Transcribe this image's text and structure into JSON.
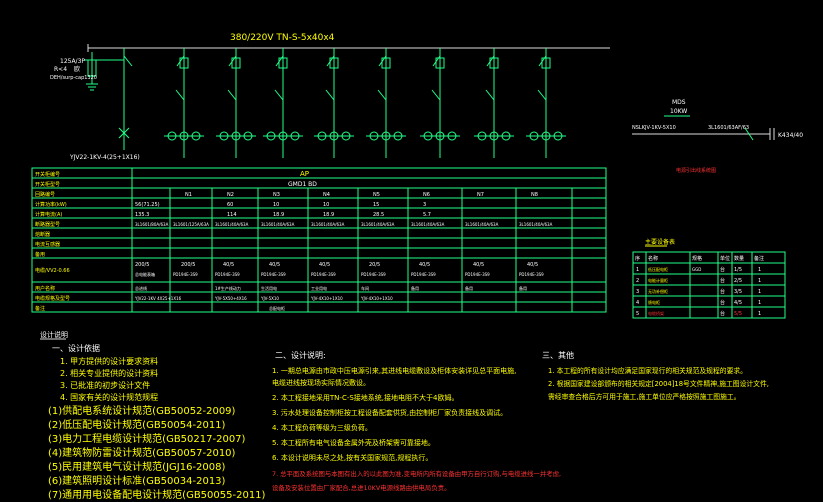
{
  "bus_label": "380/220V TN-S-5x40x4",
  "incoming": {
    "cb": "125A/3P",
    "r_label": "R<4",
    "r_unit": "欧",
    "spd": "DEH/surp-cap1320",
    "cable": "YJV22-1KV-4(25+1X16)"
  },
  "right_block": {
    "top1": "MDS",
    "top2": "10KW",
    "cable": "NSLKJV-1KV-5X10",
    "breaker": "3L1601/63AF/63",
    "code": "K434/40",
    "title": "电源引出线系统图"
  },
  "main_table": {
    "header_left": "开关柜编号",
    "panel_name": "AP",
    "panel_type": "GMD1 BD",
    "row_labels": [
      "开关柜编号",
      "开关柜型号",
      "回路编号",
      "计算功率(kW)",
      "计算电流(A)",
      "断路器型号",
      "熔断器",
      "电流互感器",
      "备用",
      "电缆/VV2-0.66",
      "用户名称",
      "电缆规格及型号",
      "备注"
    ],
    "columns": [
      "N1",
      "N2",
      "N3",
      "N4",
      "N5",
      "N6",
      "N7",
      "N8"
    ],
    "power": [
      "56(71.25)",
      "60",
      "10",
      "10",
      "15",
      "3",
      "",
      ""
    ],
    "current": [
      "135.3",
      "114",
      "18.9",
      "18.9",
      "28.5",
      "5.7",
      "",
      ""
    ],
    "breaker_lead": "3L1601/80A/63A",
    "breakers": [
      "3L1601/125A/63A",
      "3L1601/40A/63A",
      "3L1601/40A/63A",
      "3L1601/40A/63A",
      "3L1601/40A/63A",
      "3L1601/40A/63A",
      "3L1601/40A/63A",
      "3L1601/40A/63A"
    ],
    "ct_lead": "200/5",
    "ct": [
      "200/5",
      "40/5",
      "40/5",
      "40/5",
      "20/5",
      "40/5",
      "40/5",
      "40/5"
    ],
    "meter_lead": "总电能表箱",
    "meters": [
      "PD194E-3S9",
      "PD194E-3S9",
      "PD194E-3S9",
      "PD194E-3S9",
      "PD194E-3S9",
      "PD194E-3S9",
      "PD194E-3S9",
      "PD194E-3S9"
    ],
    "users": [
      "总进线",
      "1#生产线动力",
      "生活用电",
      "工业用电",
      "车间",
      "备用",
      "备用",
      "备用"
    ],
    "cables": [
      "YJV22-1KV 4X25+1X16",
      "YJV-5X50+4X16",
      "YJV-5X10",
      "YJV-4X10+1X10",
      "YJV-4X10+1X10",
      "",
      "",
      ""
    ],
    "notes": [
      "",
      "",
      "总配电柜",
      "",
      "",
      "",
      "",
      ""
    ]
  },
  "small_table": {
    "title": "主要设备表",
    "headers": [
      "序",
      "名称",
      "规格",
      "单位",
      "数量",
      "备注"
    ],
    "rows": [
      {
        "no": "1",
        "name": "低压配电柜",
        "spec": "GGD",
        "unit": "台",
        "qty": "1/5",
        "note": "1"
      },
      {
        "no": "2",
        "name": "电能计量柜",
        "spec": "",
        "unit": "台",
        "qty": "2/5",
        "note": "1"
      },
      {
        "no": "3",
        "name": "无功补偿柜",
        "spec": "",
        "unit": "台",
        "qty": "3/5",
        "note": "1"
      },
      {
        "no": "4",
        "name": "馈电柜",
        "spec": "",
        "unit": "台",
        "qty": "4/5",
        "note": "1"
      },
      {
        "no": "5",
        "name": "电缆桥架",
        "spec": "",
        "unit": "台",
        "qty": "5/5",
        "note": "1"
      }
    ]
  },
  "notes": {
    "heading": "设计说明",
    "section1": {
      "title": "一、设计依据",
      "items": [
        "1. 甲方提供的设计要求资料",
        "2. 相关专业提供的设计资料",
        "3. 已批准的初步设计文件",
        "4. 国家有关的设计规范规程"
      ],
      "standards": [
        "(1) 供配电系统设计规范(GB50052-2009)",
        "(2) 低压配电设计规范(GB50054-2011)",
        "(3) 电力工程电缆设计规范(GB50217-2007)",
        "(4) 建筑物防雷设计规范(GB50057-2010)",
        "(5) 民用建筑电气设计规范(JGJ16-2008)",
        "(6) 通用用电设备配电设计规范(GB50055-2011)"
      ],
      "standards_display": [
        "(1)供配电系统设计规范(GB50052-2009)",
        "(2)低压配电设计规范(GB50054-2011)",
        "(3)电力工程电缆设计规范(GB50217-2007)",
        "(4)建筑物防雷设计规范(GB50057-2010)",
        "(5)民用建筑电气设计规范(JGJ16-2008)",
        "(6)建筑照明设计标准(GB50034-2013)",
        "(7)通用用电设备配电设计规范(GB50055-2011)"
      ]
    },
    "section2": {
      "title": "二、设计说明:",
      "items": [
        "1. 一期总电源由市政中压电源引来,其进线电缆敷设及柜体安装详见总平面电施,",
        "   电缆进线按现场实际情况敷设。",
        "2. 本工程接地采用TN-C-S接地系统,接地电阻不大于4欧姆。",
        "3. 污水处理设备控制柜按工程设备配套供货,由控制柜厂家负责接线及调试。",
        "4. 本工程负荷等级为三级负荷。",
        "5. 本工程所有电气设备金属外壳及桥架需可靠接地。",
        "6. 本设计说明未尽之处,按有关国家规范,规程执行。"
      ],
      "red": [
        "7. 总平面及系统图与本图有出入的以此图为准,变电所内所有设备由甲方自行订购,与电缆进线一并考虑,",
        "   设备及安装位置由厂家配合,总进10KV电源线路由供电局负责。"
      ]
    },
    "section3": {
      "title": "三、其他",
      "items": [
        "1. 本工程的所有设计均应满足国家现行的相关规范及规程的要求。",
        "2. 根据国家建设部颁布的相关规定[2004]18号文件精神,施工图设计文件,",
        "   需经审查合格后方可用于施工,施工单位应严格按照施工图施工。"
      ],
      "year": "[2004]"
    }
  }
}
